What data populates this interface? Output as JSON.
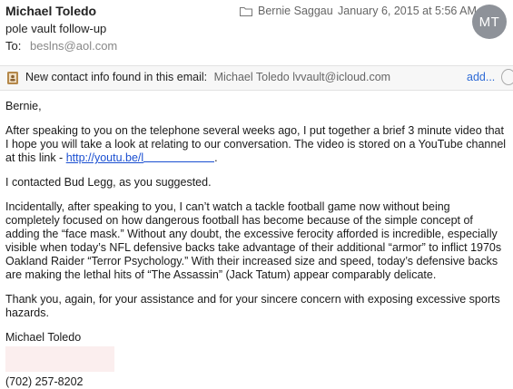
{
  "header": {
    "sender": "Michael Toledo",
    "subject": "pole vault follow-up",
    "to_label": "To:",
    "to_value": "beslns@aol.com",
    "folder": "Bernie Saggau",
    "date": "January 6, 2015 at 5:56 AM",
    "avatar_initials": "MT"
  },
  "contact_bar": {
    "text": "New contact info found in this email:",
    "detail": "Michael Toledo lvvault@icloud.com",
    "add_label": "add..."
  },
  "body": {
    "greeting": "Bernie,",
    "p1_text": "After speaking to you on the telephone several weeks ago, I put together a brief 3 minute video that I hope you will take a look at relating to our conversation. The video is stored on a YouTube channel at this link - ",
    "p1_link": "http://youtu.be/l",
    "p1_end": ".",
    "p2": "I contacted Bud Legg, as you suggested.",
    "p3": "Incidentally, after speaking to you, I can’t watch a tackle football game now without being completely focused on how dangerous football has become because of the simple concept of adding the “face mask.” Without any doubt, the excessive ferocity afforded is incredible, especially visible when today’s NFL defensive backs take advantage of their additional “armor” to inflict 1970s Oakland Raider “Terror Psychology.” With their increased size and speed, today’s defensive backs are making the lethal hits of “The Assassin” (Jack Tatum) appear comparably delicate.",
    "p4": "Thank you, again, for your assistance and for your sincere concern with exposing excessive sports hazards.",
    "signature_name": "Michael Toledo",
    "phone": "(702) 257-8202"
  },
  "icons": {
    "folder": "folder-icon",
    "contact": "contact-card-icon",
    "close": "close-icon"
  }
}
